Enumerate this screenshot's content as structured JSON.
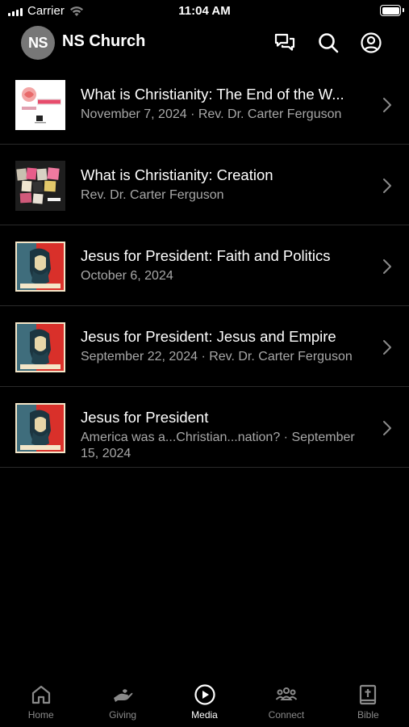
{
  "status": {
    "carrier": "Carrier",
    "time": "11:04 AM"
  },
  "header": {
    "logo_text": "NS",
    "title": "NS Church"
  },
  "media": [
    {
      "title": "What is Christianity: The End of the W...",
      "subtitle": "November 7, 2024 · Rev. Dr. Carter Ferguson",
      "thumb": "sermon-art"
    },
    {
      "title": "What is Christianity: Creation",
      "subtitle": "Rev. Dr. Carter Ferguson",
      "thumb": "collage-art"
    },
    {
      "title": "Jesus for President: Faith and Politics",
      "subtitle": "October 6, 2024",
      "thumb": "jesus-poster"
    },
    {
      "title": "Jesus for President: Jesus and Empire",
      "subtitle": "September 22, 2024 · Rev. Dr. Carter Ferguson",
      "thumb": "jesus-poster"
    },
    {
      "title": "Jesus for President",
      "subtitle": "America was a...Christian...nation? · September 15, 2024",
      "thumb": "jesus-poster"
    }
  ],
  "tabs": [
    {
      "label": "Home",
      "icon": "home-icon",
      "active": false
    },
    {
      "label": "Giving",
      "icon": "giving-icon",
      "active": false
    },
    {
      "label": "Media",
      "icon": "play-icon",
      "active": true
    },
    {
      "label": "Connect",
      "icon": "people-icon",
      "active": false
    },
    {
      "label": "Bible",
      "icon": "bible-icon",
      "active": false
    }
  ],
  "colors": {
    "background": "#000000",
    "text_primary": "#ffffff",
    "text_secondary": "#a8a8a8",
    "tab_inactive": "#8a8a8a"
  }
}
